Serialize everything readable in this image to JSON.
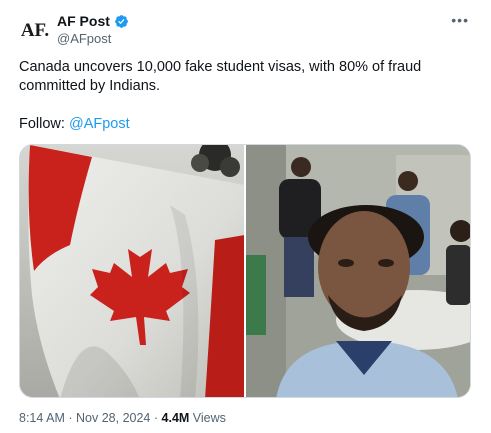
{
  "author": {
    "avatar_text": "AF.",
    "name": "AF Post",
    "handle": "@AFpost",
    "verified": true
  },
  "tweet": {
    "text": "Canada uncovers 10,000 fake student visas, with 80% of fraud committed by Indians.",
    "follow_prefix": "Follow: ",
    "follow_handle": "@AFpost"
  },
  "meta": {
    "time": "8:14 AM",
    "date": "Nov 28, 2024",
    "separator": "·",
    "views_count": "4.4M",
    "views_label": "Views"
  },
  "colors": {
    "link": "#1d9bf0",
    "verified": "#1d9bf0",
    "secondary_text": "#536471",
    "flag_red": "#c9211b"
  },
  "icons": {
    "more": "more-horizontal-icon",
    "verified": "verified-badge-icon"
  }
}
